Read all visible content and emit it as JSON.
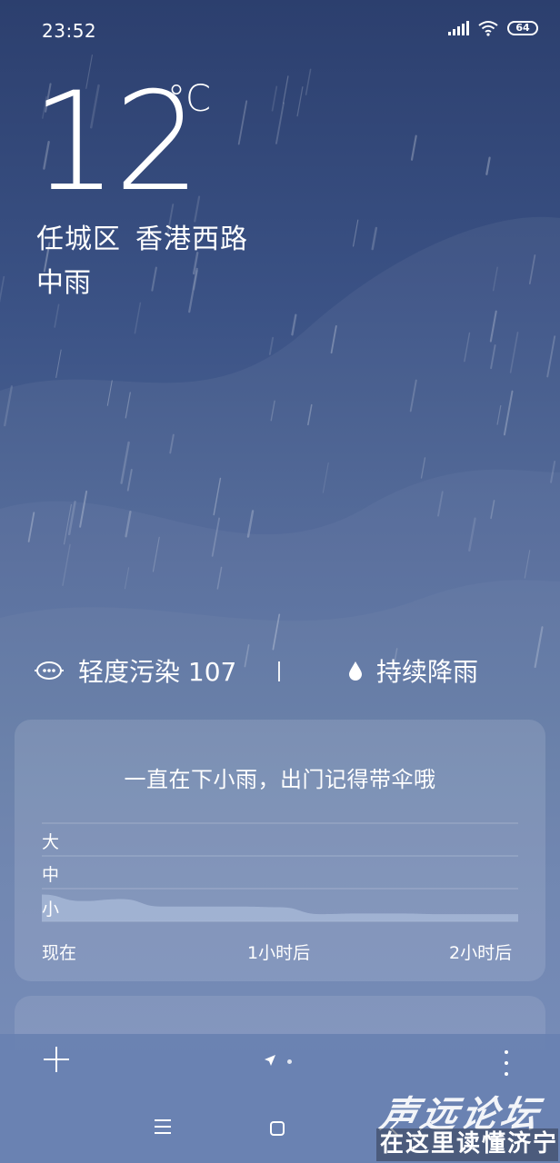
{
  "status_bar": {
    "time": "23:52",
    "battery": "64",
    "icons": [
      "signal-icon",
      "wifi-icon",
      "battery-icon"
    ]
  },
  "weather": {
    "temperature": "12",
    "unit": "°C",
    "district": "任城区",
    "street": "香港西路",
    "condition": "中雨"
  },
  "info_row": {
    "aqi_label": "轻度污染 107",
    "divider": "|",
    "rain_label": "持续降雨"
  },
  "precip_card": {
    "title": "一直在下小雨，出门记得带伞哦",
    "y_levels": [
      "大",
      "中",
      "小"
    ],
    "x_labels": [
      "现在",
      "1小时后",
      "2小时后"
    ]
  },
  "chart_data": {
    "type": "area",
    "title": "",
    "xlabel": "",
    "ylabel": "",
    "categories_y": [
      "小",
      "中",
      "大"
    ],
    "x_ticks": [
      "现在",
      "1小时后",
      "2小时后"
    ],
    "x_minutes": [
      0,
      10,
      20,
      30,
      40,
      50,
      60,
      70,
      80,
      90,
      100,
      110,
      120
    ],
    "values": [
      0.82,
      0.62,
      0.68,
      0.45,
      0.45,
      0.45,
      0.43,
      0.22,
      0.24,
      0.24,
      0.22,
      0.22,
      0.22
    ],
    "ylim": [
      0,
      3
    ],
    "grid": true
  },
  "bottom_bar": {
    "add_icon": "plus-icon",
    "location_icon": "location-arrow-icon",
    "more_icon": "more-vertical-icon"
  },
  "nav_bar": {
    "icons": [
      "menu-icon",
      "home-icon",
      "back-icon"
    ]
  },
  "watermark": {
    "line1": "声远论坛",
    "line2": "在这里读懂济宁"
  },
  "colors": {
    "bg_top": "#2c3f6e",
    "bg_bottom": "#6a82b2",
    "chart_fill": "#a6b7d6"
  }
}
